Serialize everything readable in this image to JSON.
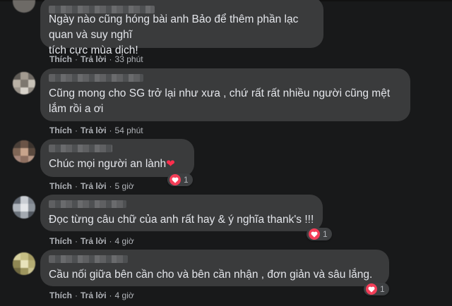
{
  "actions": {
    "like": "Thích",
    "reply": "Trả lời",
    "sep": "·"
  },
  "colors": {
    "background": "#18191a",
    "bubble": "#3a3b3c",
    "meta": "#b0b3b8",
    "heart": "#f33e58"
  },
  "comments": [
    {
      "text": "Ngày nào cũng hóng bài anh Bảo để thêm phần lạc quan và suy nghĩ\ntích cực mùa dịch!",
      "time": "33 phút",
      "reaction_count": null
    },
    {
      "text": "Cũng mong cho SG trở lại như xưa , chứ rất rất nhiều người cũng mệt\nlắm rồi a ơi",
      "time": "54 phút",
      "reaction_count": null
    },
    {
      "text": "Chúc mọi người an lành",
      "emoji": "❤",
      "time": "5 giờ",
      "reaction_count": "1"
    },
    {
      "text": "Đọc từng câu chữ của anh rất hay & ý nghĩa thank's !!!",
      "time": "4 giờ",
      "reaction_count": "1"
    },
    {
      "text": "Cầu nối giữa bên cần cho và bên cần nhận , đơn giản và sâu lắng.",
      "time": "4 giờ",
      "reaction_count": "1"
    }
  ]
}
